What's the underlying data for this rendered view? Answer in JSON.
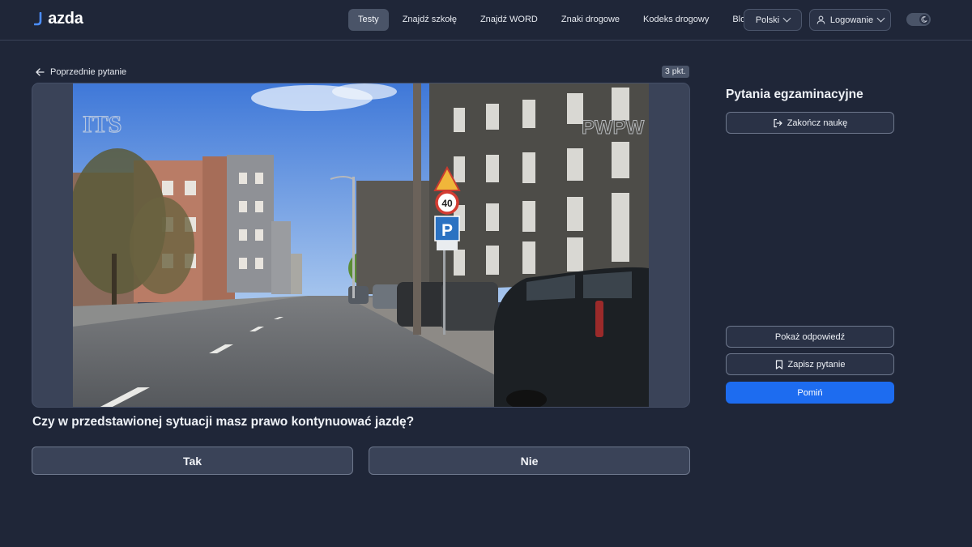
{
  "header": {
    "logo_text": "jazda",
    "nav": [
      {
        "label": "Testy",
        "active": true
      },
      {
        "label": "Znajdź szkołę",
        "active": false
      },
      {
        "label": "Znajdź WORD",
        "active": false
      },
      {
        "label": "Znaki drogowe",
        "active": false
      },
      {
        "label": "Kodeks drogowy",
        "active": false
      },
      {
        "label": "Blog",
        "active": false
      }
    ],
    "language": "Polski",
    "login": "Logowanie",
    "theme": "dark"
  },
  "question": {
    "back_label": "Poprzednie pytanie",
    "points": "3 pkt.",
    "text": "Czy w przedstawionej sytuacji masz prawo kontynuować jazdę?",
    "answers": [
      "Tak",
      "Nie"
    ],
    "media": {
      "watermark_left": "ITS",
      "watermark_right": "PWPW",
      "speed_limit_sign": "40",
      "parking_sign": "P"
    }
  },
  "panel": {
    "title": "Pytania egzaminacyjne",
    "end_label": "Zakończ naukę",
    "show_answer_label": "Pokaż odpowiedź",
    "save_label": "Zapisz pytanie",
    "skip_label": "Pomiń"
  },
  "colors": {
    "background": "#1f2638",
    "accent": "#1d6cf0",
    "button_fill": "#3a4358"
  }
}
